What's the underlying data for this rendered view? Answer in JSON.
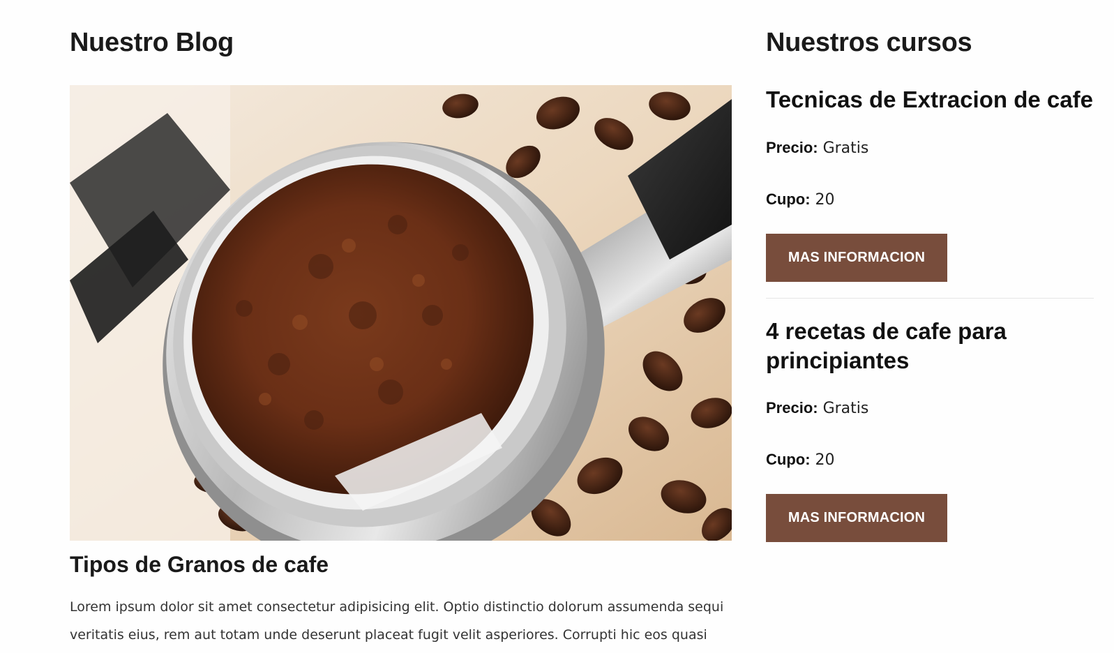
{
  "blog": {
    "heading": "Nuestro Blog",
    "post": {
      "title": "Tipos de Granos de cafe",
      "excerpt": "Lorem ipsum dolor sit amet consectetur adipisicing elit. Optio distinctio dolorum assumenda sequi veritatis eius, rem aut totam unde deserunt placeat fugit velit asperiores. Corrupti hic eos quasi"
    }
  },
  "courses": {
    "heading": "Nuestros cursos",
    "price_label": "Precio:",
    "capacity_label": "Cupo:",
    "items": [
      {
        "title": "Tecnicas de Extracion de cafe",
        "price": "Gratis",
        "capacity": "20",
        "button_label": "MAS INFORMACION"
      },
      {
        "title": "4 recetas de cafe para principiantes",
        "price": "Gratis",
        "capacity": "20",
        "button_label": "MAS INFORMACION"
      }
    ]
  },
  "colors": {
    "button_bg": "#784d3c",
    "button_text": "#ffffff",
    "heading_text": "#111111"
  }
}
